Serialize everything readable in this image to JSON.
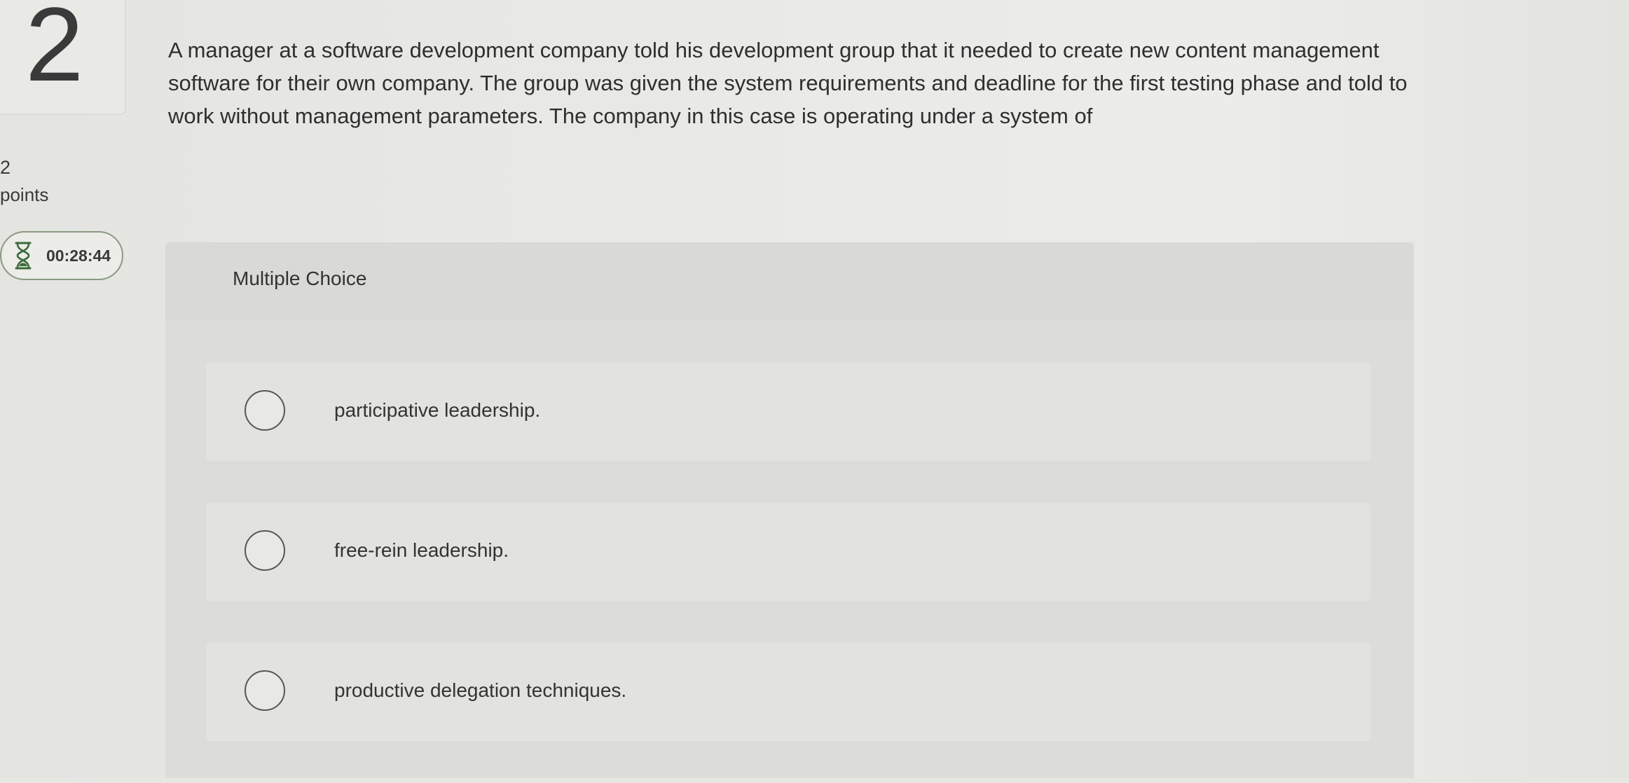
{
  "question": {
    "number": "2",
    "points_value": "2",
    "points_label": "points",
    "timer": "00:28:44",
    "text": "A manager at a software development company told his development group that it needed to create new content management software for their own company. The group was given the system requirements and deadline for the first testing phase and told to work without management parameters. The company in this case is operating under a system of"
  },
  "answer_panel": {
    "title": "Multiple Choice",
    "options": [
      {
        "label": "participative leadership."
      },
      {
        "label": "free-rein leadership."
      },
      {
        "label": "productive delegation techniques."
      }
    ]
  },
  "icons": {
    "timer": "hourglass-icon"
  },
  "colors": {
    "timer_border": "#8a9a80",
    "text": "#333333"
  }
}
